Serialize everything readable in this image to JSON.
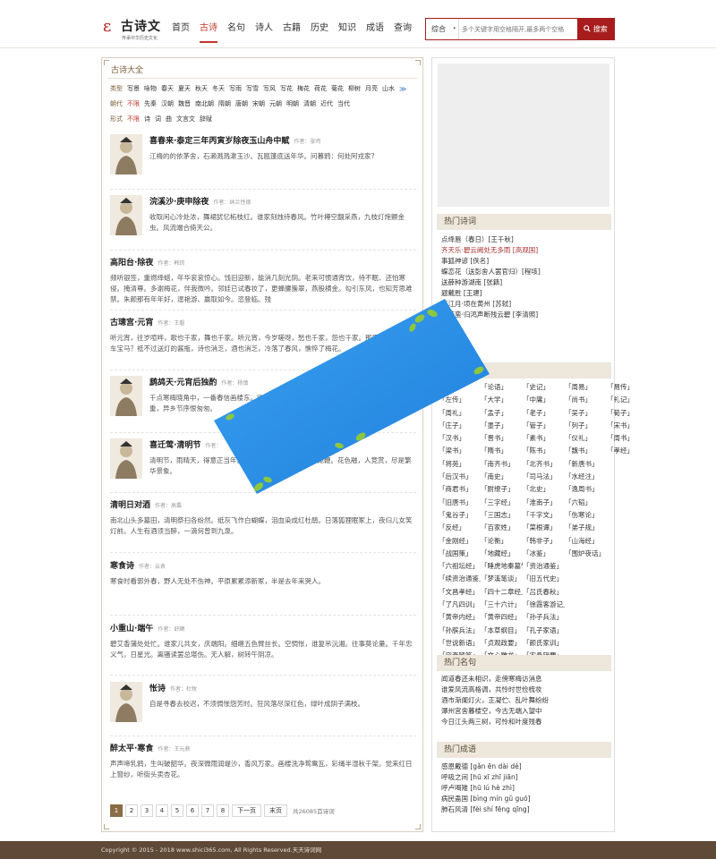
{
  "header": {
    "logo_mark": "ε",
    "logo_name": "古诗文",
    "logo_slogan": "传承中华历史文化",
    "nav": [
      {
        "label": "首页",
        "active": false
      },
      {
        "label": "古诗",
        "active": true
      },
      {
        "label": "名句",
        "active": false
      },
      {
        "label": "诗人",
        "active": false
      },
      {
        "label": "古籍",
        "active": false
      },
      {
        "label": "历史",
        "active": false
      },
      {
        "label": "知识",
        "active": false
      },
      {
        "label": "成语",
        "active": false
      },
      {
        "label": "查询",
        "active": false
      }
    ],
    "search": {
      "category": "综合",
      "arrow": "▾",
      "placeholder": "多个关键字用空格隔开,最多两个空格",
      "button_label": "搜索",
      "button_icon": "search-icon"
    }
  },
  "panel": {
    "title": "古诗大全",
    "filters": {
      "type": {
        "label": "类型",
        "items": [
          "写景",
          "咏物",
          "春天",
          "夏天",
          "秋天",
          "冬天",
          "写雨",
          "写雪",
          "写风",
          "写花",
          "梅花",
          "荷花",
          "菊花",
          "柳树",
          "月亮",
          "山水"
        ],
        "more": "≫"
      },
      "dynasty": {
        "label": "朝代",
        "selected": "不限",
        "items": [
          "先秦",
          "汉朝",
          "魏晋",
          "南北朝",
          "隋朝",
          "唐朝",
          "宋朝",
          "元朝",
          "明朝",
          "清朝",
          "近代",
          "当代"
        ]
      },
      "form": {
        "label": "形式",
        "selected": "不限",
        "items": [
          "诗",
          "词",
          "曲",
          "文言文",
          "辞赋"
        ]
      }
    },
    "poems": [
      {
        "title": "喜春来·泰定三年丙寅岁除夜玉山舟中赋",
        "author_label": "作者：",
        "author": "张鸣",
        "text": "江梅的的依茅舍，石濑溅溅漱玉沙。瓦瓯篷底送年华。问暮鸦：何处阿戎家?"
      },
      {
        "title": "浣溪沙·庚申除夜",
        "author_label": "作者：",
        "author": "纳兰性德",
        "text": "收取闲心冷处浓，舞裙犹忆柘枝红。谁家刻烛待春风。竹叶樽空翻采燕，九枝灯炧颤金虫。风流端合倚天公。"
      },
      {
        "title": "高阳台·除夜",
        "author_label": "作者：",
        "author": "韩琮",
        "text": "频听银签，重燃绛蜡，年华衮衮惊心。饯旧迎新，能消几刻光阴。老来可惯通宵饮，待不眠、还怕寒侵。掩清尊。多谢梅花，伴我微吟。邻娃已试春妆了，更蜂腰簇翠，燕股横金。勾引东风，也知芳思难禁。朱颜那有年年好，逞艳游、赢取如今。恣登临。残"
      },
      {
        "title": "古璁宫·元宵",
        "author_label": "作者：",
        "author": "王磐",
        "text": "听元宵，往岁喧哗，歌也千家，舞也千家。听元宵，今岁嗟呀，愁也千家，怨也千家。那里有闹红尘香车宝马？祗不过送灯的酱瓶，诗也消乏，酒也消乏，冷落了春风，憔悴了梅花。"
      },
      {
        "title": "鹧鸪天·元宵后独酌",
        "author_label": "作者：",
        "author": "杨慎",
        "text": "千点寒梅晓角中，一番春信画楼东。收灯庭院迟迟月，落索秋千翦翦风。鱼雁杳，水云重，异乡节序恨匆匆。"
      },
      {
        "title": "喜迁莺·清明节",
        "author_label": "作者：",
        "author": "",
        "text": "清明节，雨晴天，得意正当年。马骄泥软锦连乾，香袖半笼鞭。花色融，人竞赏，尽是繁华景象。"
      },
      {
        "title": "清明日对酒",
        "author_label": "作者：",
        "author": "高翥",
        "text": "南北山头多墓田，清明祭扫各纷然。纸灰飞作白蝴蝶，泪血染成红杜鹃。日落狐狸眠冢上，夜归儿女笑灯前。人生有酒须当醉，一滴何曾到九泉。"
      },
      {
        "title": "寒食诗",
        "author_label": "作者：",
        "author": "云表",
        "text": "寒食时看郭外春，野人无处不伤神。平原累累添新冢，半是去年来哭人。"
      },
      {
        "title": "小重山·端午",
        "author_label": "作者：",
        "author": "舒頔",
        "text": "碧艾香蒲处处忙。谁家儿共女，庆端阳。细缠五色臂丝长。空惆怅，谁复吊沅湘。往事莫论量。千年忠义气，日星光。离骚读罢总堪伤。无人解，树转午阴凉。"
      },
      {
        "title": "怅诗",
        "author_label": "作者：",
        "author": "杜牧",
        "text": "自是寻春去校迟，不须惆怅怨芳时。狂风落尽深红色，绿叶成阴子满枝。"
      },
      {
        "title": "醉太平·寒食",
        "author_label": "作者：",
        "author": "王元鼎",
        "text": "声声啼乳鸦，生叫破韶华。夜深微雨润堤沙，香风万家。画楼洗净鸳鸯瓦，彩绳半湿秋千架。觉来红日上窗纱，听街头卖杏花。"
      }
    ],
    "pager": {
      "pages": [
        "1",
        "2",
        "3",
        "4",
        "5",
        "6",
        "7",
        "8"
      ],
      "current": "1",
      "next": "下一页",
      "last": "末页",
      "total": "共26085首诗词"
    }
  },
  "sidebar": {
    "hot_poems_title": "热门诗词",
    "hot_poems": [
      {
        "text": "点绛唇（春日）[王千秋]",
        "hl": false
      },
      {
        "text": "齐天乐·碧云阙处无多雨 [高观国]",
        "hl": true
      },
      {
        "text": "事狐神谚 [佚名]",
        "hl": false
      },
      {
        "text": "蝶恋花（送彭舍人罢官归）[程垓]",
        "hl": false
      },
      {
        "text": "送薛种游湖南 [张籍]",
        "hl": false
      },
      {
        "text": "题戴胜 [王建]",
        "hl": false
      },
      {
        "text": "西江月·顷在黄州 [苏轼]",
        "hl": false
      },
      {
        "text": "菩萨蛮·归鸿声断残云碧 [李清照]",
        "hl": false
      },
      {
        "text": "",
        "hl": false
      },
      {
        "text": "",
        "hl": false
      }
    ],
    "books_title": "热门古籍",
    "books": [
      "论语",
      "史记",
      "周易",
      "易传",
      "左传",
      "大学",
      "中庸",
      "尚书",
      "礼记",
      "周礼",
      "孟子",
      "老子",
      "吴子",
      "荀子",
      "庄子",
      "墨子",
      "管子",
      "列子",
      "宋书",
      "汉书",
      "晋书",
      "素书",
      "仪礼",
      "周书",
      "梁书",
      "隋书",
      "陈书",
      "魏书",
      "孝经",
      "将苑",
      "南齐书",
      "北齐书",
      "新唐书",
      "后汉书",
      "南史",
      "司马法",
      "水经注",
      "商君书",
      "尉缭子",
      "北史",
      "逸周书",
      "旧唐书",
      "三字经",
      "淮南子",
      "六韬",
      "鬼谷子",
      "三国志",
      "千字文",
      "伤寒论",
      "反经",
      "百家姓",
      "菜根谭",
      "弟子规",
      "金刚经",
      "论衡",
      "韩非子",
      "山海经",
      "战国策",
      "地藏经",
      "冰鉴",
      "围炉夜话",
      "六祖坛经",
      "睡虎地秦墓竹简",
      "资治通鉴",
      "续资治通鉴",
      "梦溪笔谈",
      "旧五代史",
      "文昌孝经",
      "四十二章经",
      "吕氏春秋",
      "了凡四训",
      "三十六计",
      "徐霞客游记",
      "黄帝内经",
      "黄帝四经",
      "孙子兵法",
      "孙膑兵法",
      "本草纲目",
      "孔子家语",
      "世说新语",
      "贞观政要",
      "颜氏家训",
      "容斋随笔",
      "文心雕龙",
      "农桑辑要"
    ],
    "book_rows": [
      [
        "",
        "论语",
        "史记",
        "周易",
        "易传"
      ],
      [
        "左传",
        "大学",
        "中庸",
        "尚书",
        "礼记"
      ],
      [
        "周礼",
        "孟子",
        "老子",
        "吴子",
        "荀子"
      ],
      [
        "庄子",
        "墨子",
        "管子",
        "列子",
        "宋书"
      ],
      [
        "汉书",
        "晋书",
        "素书",
        "仪礼",
        "周书"
      ],
      [
        "梁书",
        "隋书",
        "陈书",
        "魏书",
        "孝经"
      ],
      [
        "将苑",
        "南齐书",
        "北齐书",
        "新唐书"
      ],
      [
        "后汉书",
        "南史",
        "司马法",
        "水经注"
      ],
      [
        "商君书",
        "尉缭子",
        "北史",
        "逸周书"
      ],
      [
        "旧唐书",
        "三字经",
        "淮南子",
        "六韬"
      ],
      [
        "鬼谷子",
        "三国志",
        "千字文",
        "伤寒论"
      ],
      [
        "反经",
        "百家姓",
        "菜根谭",
        "弟子规"
      ],
      [
        "金刚经",
        "论衡",
        "韩非子",
        "山海经"
      ],
      [
        "战国策",
        "地藏经",
        "冰鉴",
        "围炉夜话"
      ],
      [
        "六祖坛经",
        "睡虎地秦墓竹简",
        "资治通鉴"
      ],
      [
        "续资治通鉴",
        "梦溪笔谈",
        "旧五代史"
      ],
      [
        "文昌孝经",
        "四十二章经",
        "吕氏春秋"
      ],
      [
        "了凡四训",
        "三十六计",
        "徐霞客游记"
      ],
      [
        "黄帝内经",
        "黄帝四经",
        "孙子兵法"
      ],
      [
        "孙膑兵法",
        "本草纲目",
        "孔子家语"
      ],
      [
        "世说新语",
        "贞观政要",
        "颜氏家训"
      ],
      [
        "容斋随笔",
        "文心雕龙",
        "农桑辑要"
      ]
    ],
    "quotes_title": "热门名句",
    "quotes": [
      "闻道春还未相识，走傍寒梅访消息",
      "谁爱风流高格调，共怜时世俭梳妆",
      "酒市渐阑灯火，正凝伫、乱叶舞纷纷",
      "潭州宫舍暮楼空，今古无端入望中",
      "今日江头两三树，可怜和叶度残春"
    ],
    "idioms_title": "热门成语",
    "idioms": [
      "感恩戴德 [gǎn ēn dài dé]",
      "呼吸之间 [hū xī zhī jiān]",
      "呼卢喝雉 [hū lú hè zhì]",
      "病民蛊国 [bìng mín gǔ guó]",
      "肺石风清 [fèi shí fēng qīng]"
    ]
  },
  "overlay": {
    "colors": {
      "base": "#2f8de4",
      "deep": "#1565c0",
      "leaf": "#8dc63f"
    }
  },
  "footer": {
    "text": "Copyright © 2015 - 2018 www.shici365.com, All Rights Reserved.天天诗词网"
  },
  "colors": {
    "accent": "#a71d1d",
    "panel_title": "#7a5b35",
    "footer_bg": "#5e4a37",
    "section_bg": "#ede7dc"
  }
}
